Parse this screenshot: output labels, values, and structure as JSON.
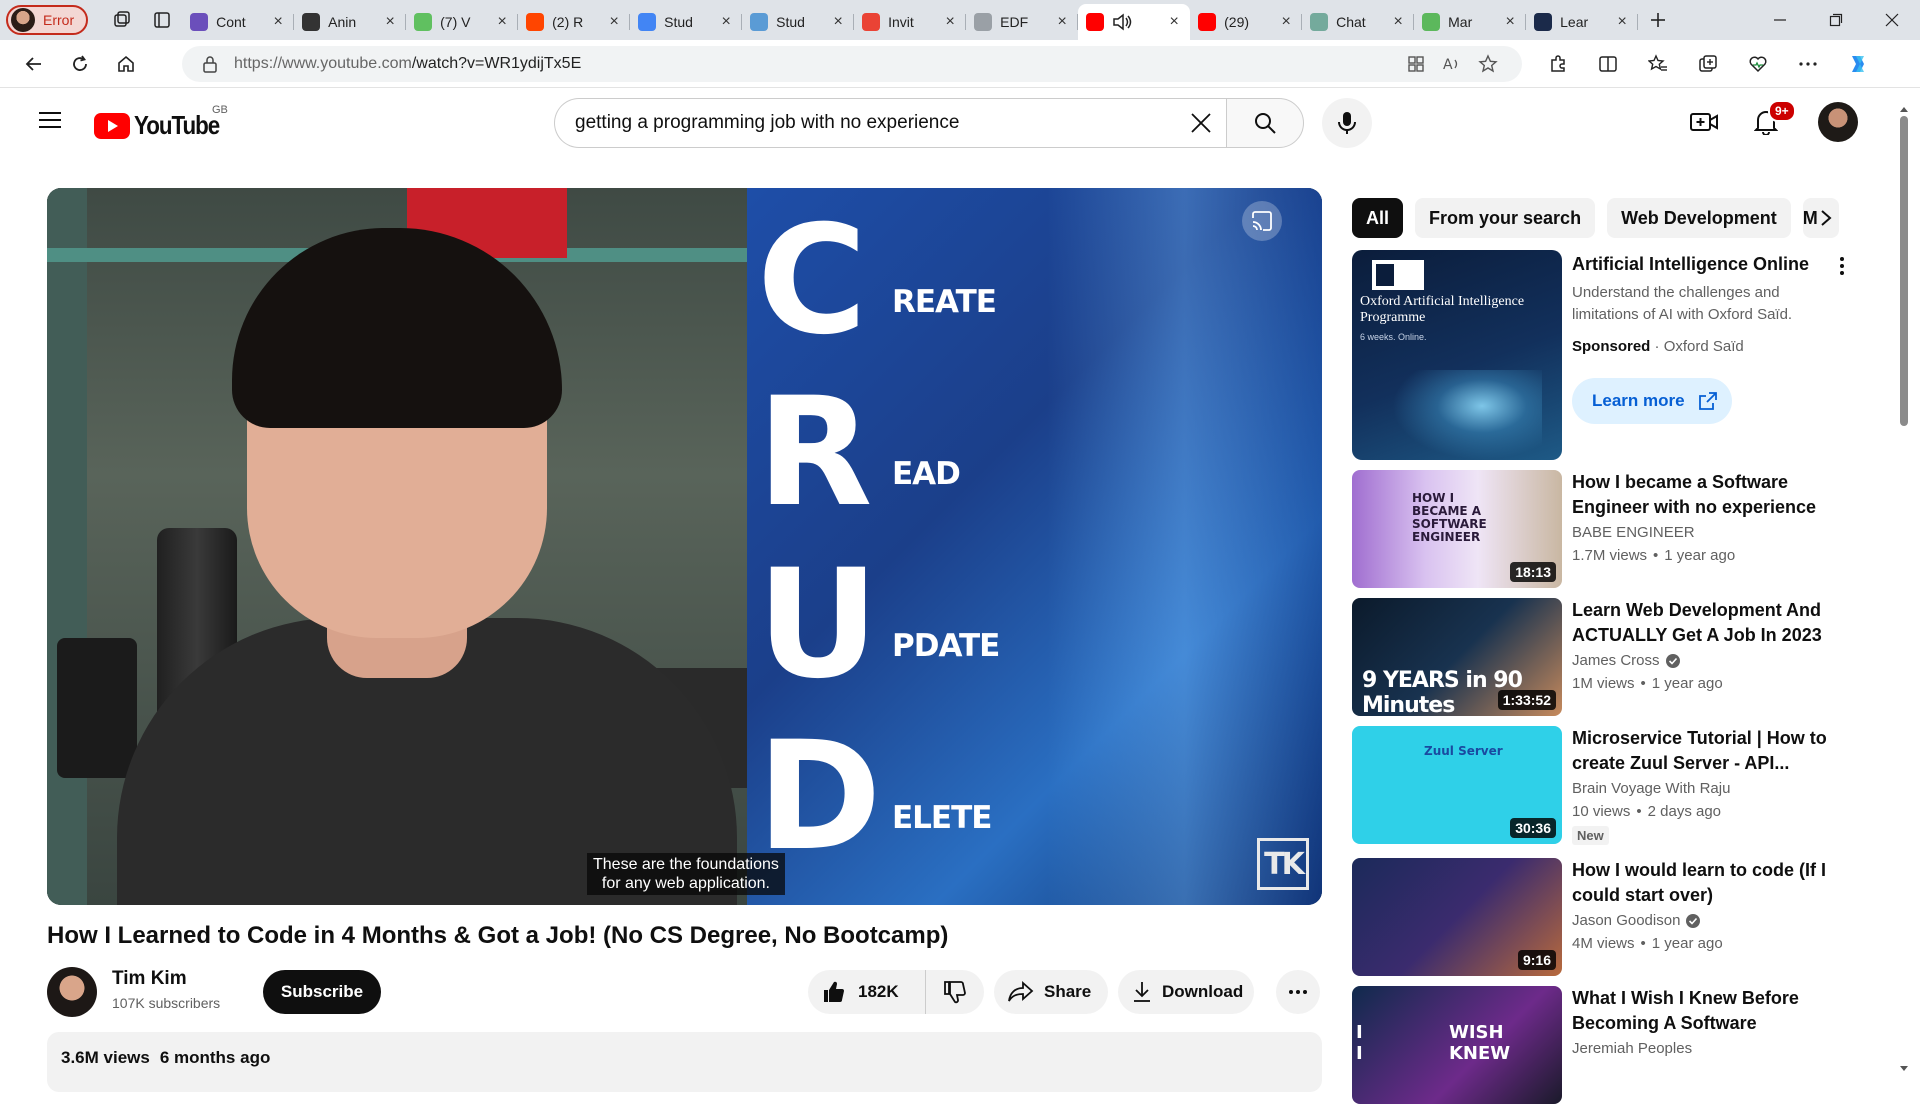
{
  "browser": {
    "profile_label": "Error",
    "tabs": [
      {
        "title": "Cont",
        "favicon_color": "#6b4fbb"
      },
      {
        "title": "Anin",
        "favicon_color": "#333333"
      },
      {
        "title": "(7) V",
        "favicon_color": "#60c060"
      },
      {
        "title": "(2) R",
        "favicon_color": "#ff4500"
      },
      {
        "title": "Stud",
        "favicon_color": "#4285f4"
      },
      {
        "title": "Stud",
        "favicon_color": "#5a9bd5"
      },
      {
        "title": "Invit",
        "favicon_color": "#ea4335"
      },
      {
        "title": "EDF",
        "favicon_color": "#9aa0a6"
      },
      {
        "title": "",
        "favicon_color": "#ff0000",
        "active": true
      },
      {
        "title": "(29)",
        "favicon_color": "#ff0000"
      },
      {
        "title": "Chat",
        "favicon_color": "#74aa9c"
      },
      {
        "title": "Mar",
        "favicon_color": "#5cb85c"
      },
      {
        "title": "Lear",
        "favicon_color": "#1b2a4a"
      }
    ],
    "url_domain": "https://www.youtube.com",
    "url_path": "/watch?v=WR1ydijTx5E"
  },
  "header": {
    "logo_text": "YouTube",
    "country_code": "GB",
    "search_value": "getting a programming job with no experience",
    "notification_count": "9+"
  },
  "player": {
    "crud": [
      {
        "letter": "C",
        "rest": "REATE"
      },
      {
        "letter": "R",
        "rest": "EAD"
      },
      {
        "letter": "U",
        "rest": "PDATE"
      },
      {
        "letter": "D",
        "rest": "ELETE"
      }
    ],
    "watermark": "TK",
    "caption_line1": "These are the foundations",
    "caption_line2": "for any web application."
  },
  "video": {
    "title": "How I Learned to Code in 4 Months & Got a Job! (No CS Degree, No Bootcamp)",
    "channel": "Tim Kim",
    "subscribers": "107K subscribers",
    "subscribe_label": "Subscribe",
    "likes": "182K",
    "share_label": "Share",
    "download_label": "Download",
    "views": "3.6M views",
    "age": "6 months ago"
  },
  "chips": [
    "All",
    "From your search",
    "Web Development",
    "M"
  ],
  "ad": {
    "title": "Artificial Intelligence Online",
    "description": "Understand the challenges and limitations of AI with Oxford Saïd.",
    "sponsored_label": "Sponsored",
    "advertiser": "Oxford Saïd",
    "cta": "Learn more",
    "thumb_title": "Oxford Artificial Intelligence Programme",
    "thumb_subtitle": "6 weeks. Online."
  },
  "recommendations": [
    {
      "title": "How I became a Software Engineer with no experience o...",
      "channel": "BABE ENGINEER",
      "verified": false,
      "views": "1.7M views",
      "age": "1 year ago",
      "duration": "18:13",
      "thumb_text": "HOW I BECAME A SOFTWARE ENGINEER",
      "is_new": false
    },
    {
      "title": "Learn Web Development And ACTUALLY Get A Job In 2023 |...",
      "channel": "James Cross",
      "verified": true,
      "views": "1M views",
      "age": "1 year ago",
      "duration": "1:33:52",
      "thumb_text": "9 YEARS in 90 Minutes",
      "is_new": false
    },
    {
      "title": "Microservice Tutorial | How to create Zuul Server - API...",
      "channel": "Brain Voyage With Raju",
      "verified": false,
      "views": "10 views",
      "age": "2 days ago",
      "duration": "30:36",
      "thumb_text": "Zuul Server",
      "is_new": true,
      "new_label": "New"
    },
    {
      "title": "How I would learn to code (If I could start over)",
      "channel": "Jason Goodison",
      "verified": true,
      "views": "4M views",
      "age": "1 year ago",
      "duration": "9:16",
      "thumb_text": "",
      "is_new": false
    },
    {
      "title": "What I Wish I Knew Before Becoming A Software Developer",
      "channel": "Jeremiah Peoples",
      "verified": false,
      "views": "",
      "age": "",
      "duration": "",
      "thumb_text": "I WISH I KNEW",
      "is_new": false
    }
  ]
}
